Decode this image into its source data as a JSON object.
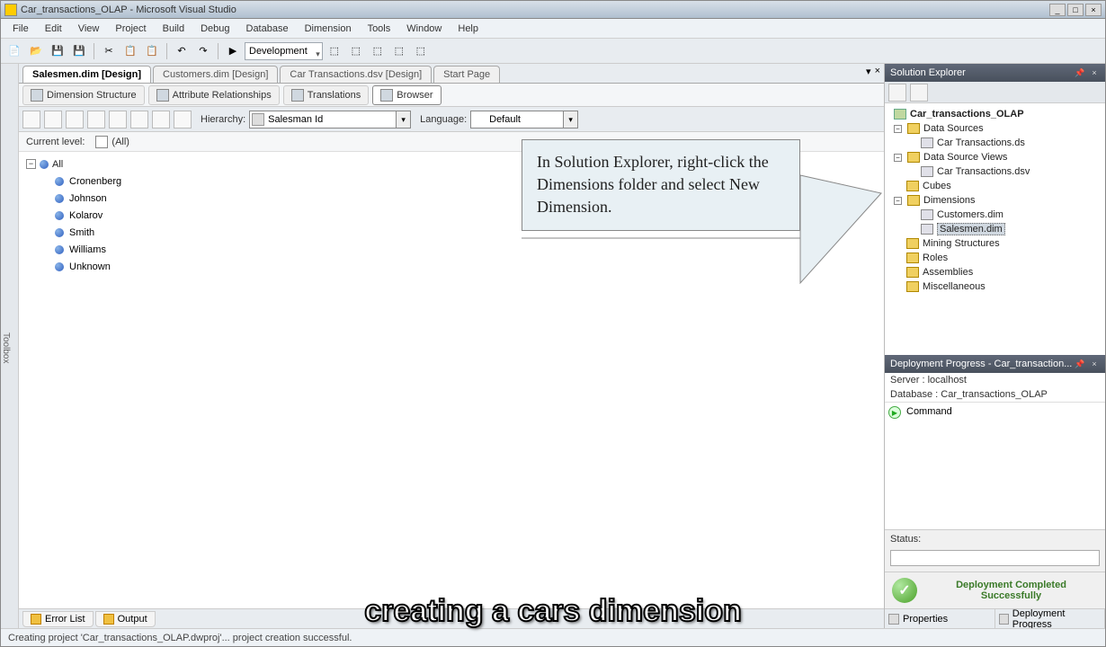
{
  "title": "Car_transactions_OLAP - Microsoft Visual Studio",
  "menu": [
    "File",
    "Edit",
    "View",
    "Project",
    "Build",
    "Debug",
    "Database",
    "Dimension",
    "Tools",
    "Window",
    "Help"
  ],
  "buildConfig": "Development",
  "tabs": [
    {
      "label": "Salesmen.dim [Design]",
      "active": true
    },
    {
      "label": "Customers.dim [Design]",
      "active": false
    },
    {
      "label": "Car Transactions.dsv [Design]",
      "active": false
    },
    {
      "label": "Start Page",
      "active": false
    }
  ],
  "designerTabs": [
    {
      "label": "Dimension Structure"
    },
    {
      "label": "Attribute Relationships"
    },
    {
      "label": "Translations"
    },
    {
      "label": "Browser",
      "active": true
    }
  ],
  "browser": {
    "hierarchyLabel": "Hierarchy:",
    "hierarchyValue": "Salesman Id",
    "languageLabel": "Language:",
    "languageValue": "Default",
    "currentLevelLabel": "Current level:",
    "currentLevelValue": "(All)",
    "rootNode": "All",
    "members": [
      "Cronenberg",
      "Johnson",
      "Kolarov",
      "Smith",
      "Williams",
      "Unknown"
    ]
  },
  "callout": "In Solution Explorer, right-click the Dimensions folder and select New Dimension.",
  "solutionExplorer": {
    "title": "Solution Explorer",
    "project": "Car_transactions_OLAP",
    "folders": [
      {
        "name": "Data Sources",
        "items": [
          "Car Transactions.ds"
        ]
      },
      {
        "name": "Data Source Views",
        "items": [
          "Car Transactions.dsv"
        ]
      },
      {
        "name": "Cubes",
        "items": []
      },
      {
        "name": "Dimensions",
        "items": [
          "Customers.dim",
          "Salesmen.dim"
        ],
        "selected": "Salesmen.dim"
      },
      {
        "name": "Mining Structures",
        "items": []
      },
      {
        "name": "Roles",
        "items": []
      },
      {
        "name": "Assemblies",
        "items": []
      },
      {
        "name": "Miscellaneous",
        "items": []
      }
    ]
  },
  "deployment": {
    "title": "Deployment Progress - Car_transaction...",
    "serverLabel": "Server :",
    "serverValue": "localhost",
    "databaseLabel": "Database :",
    "databaseValue": "Car_transactions_OLAP",
    "command": "Command",
    "statusLabel": "Status:",
    "successText": "Deployment Completed Successfully"
  },
  "bottomRightTabs": [
    "Properties",
    "Deployment Progress"
  ],
  "bottomTabs": [
    "Error List",
    "Output"
  ],
  "statusText": "Creating project 'Car_transactions_OLAP.dwproj'... project creation successful.",
  "subtitle": "creating a cars dimension"
}
